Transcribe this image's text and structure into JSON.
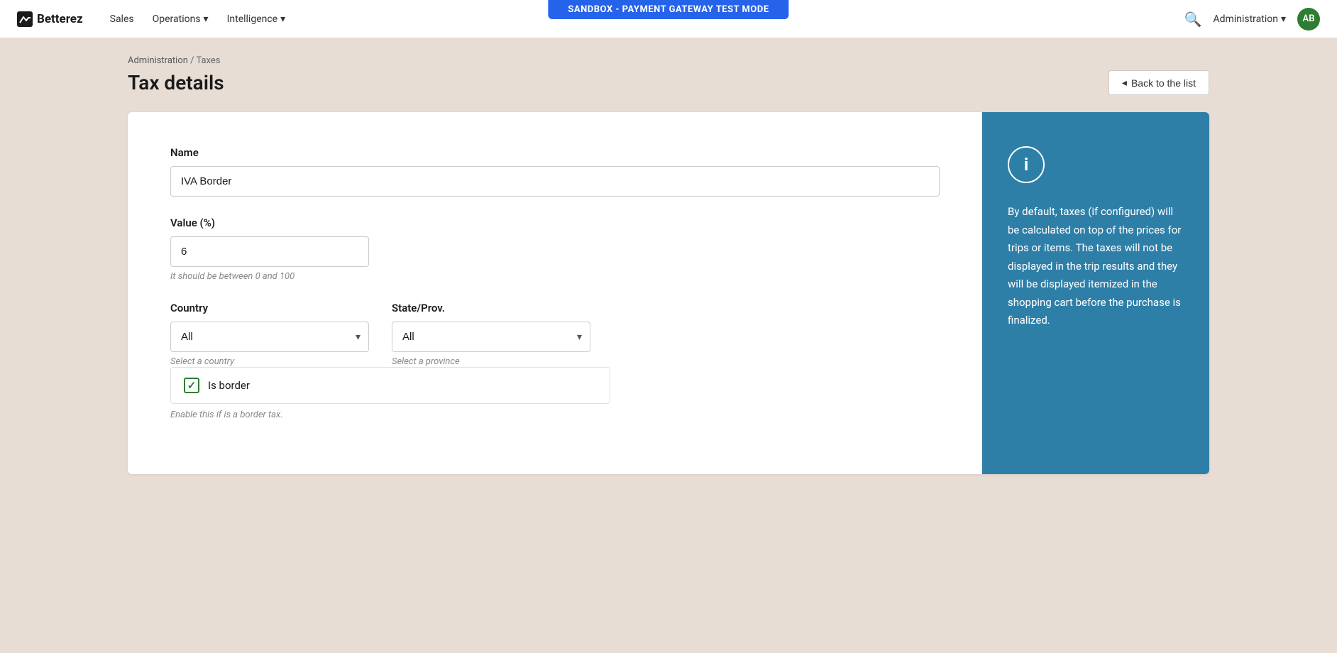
{
  "sandbox_banner": "SANDBOX - PAYMENT GATEWAY TEST MODE",
  "navbar": {
    "logo_text": "Betterez",
    "nav_links": [
      {
        "label": "Sales",
        "has_dropdown": false
      },
      {
        "label": "Operations",
        "has_dropdown": true
      },
      {
        "label": "Intelligence",
        "has_dropdown": true
      }
    ],
    "admin_label": "Administration",
    "avatar_initials": "AB",
    "search_title": "Search"
  },
  "breadcrumb": {
    "parts": [
      "Administration",
      "Taxes"
    ],
    "separator": " / "
  },
  "page": {
    "title": "Tax details",
    "back_button": "Back to the list"
  },
  "form": {
    "name_label": "Name",
    "name_value": "IVA Border",
    "name_placeholder": "",
    "value_label": "Value (%)",
    "value_value": "6",
    "value_hint": "It should be between 0 and 100",
    "country_label": "Country",
    "country_value": "All",
    "country_hint": "Select a country",
    "state_label": "State/Prov.",
    "state_value": "All",
    "state_hint": "Select a province",
    "checkbox_label": "Is border",
    "checkbox_checked": true,
    "checkbox_hint": "Enable this if is a border tax."
  },
  "info_panel": {
    "icon": "i",
    "text": "By default, taxes (if configured) will be calculated on top of the prices for trips or items. The taxes will not be displayed in the trip results and they will be displayed itemized in the shopping cart before the purchase is finalized."
  }
}
